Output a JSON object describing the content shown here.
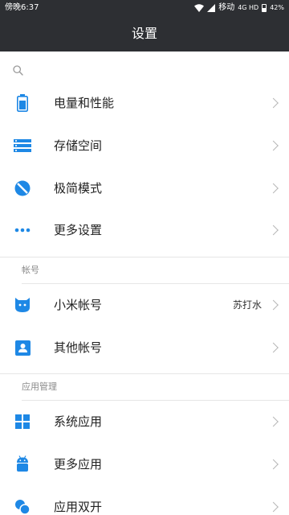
{
  "status_bar": {
    "time": "傍晚6:37",
    "carrier": "移动",
    "network": "4G HD",
    "battery_percent": "42%"
  },
  "header": {
    "title": "设置"
  },
  "colors": {
    "accent": "#1e88e5",
    "title_bar": "#2d2f33"
  },
  "search": {
    "icon": "search-icon"
  },
  "main_items": [
    {
      "label": "电量和性能",
      "icon": "battery-icon"
    },
    {
      "label": "存储空间",
      "icon": "storage-icon"
    },
    {
      "label": "极简模式",
      "icon": "minimal-mode-icon"
    },
    {
      "label": "更多设置",
      "icon": "more-dots-icon"
    }
  ],
  "sections": {
    "account": {
      "header": "帐号",
      "items": [
        {
          "label": "小米帐号",
          "value": "苏打水",
          "icon": "mi-account-icon"
        },
        {
          "label": "其他帐号",
          "icon": "person-icon"
        }
      ]
    },
    "apps": {
      "header": "应用管理",
      "items": [
        {
          "label": "系统应用",
          "icon": "grid-apps-icon"
        },
        {
          "label": "更多应用",
          "icon": "android-icon"
        },
        {
          "label": "应用双开",
          "icon": "dual-apps-icon"
        }
      ]
    }
  }
}
